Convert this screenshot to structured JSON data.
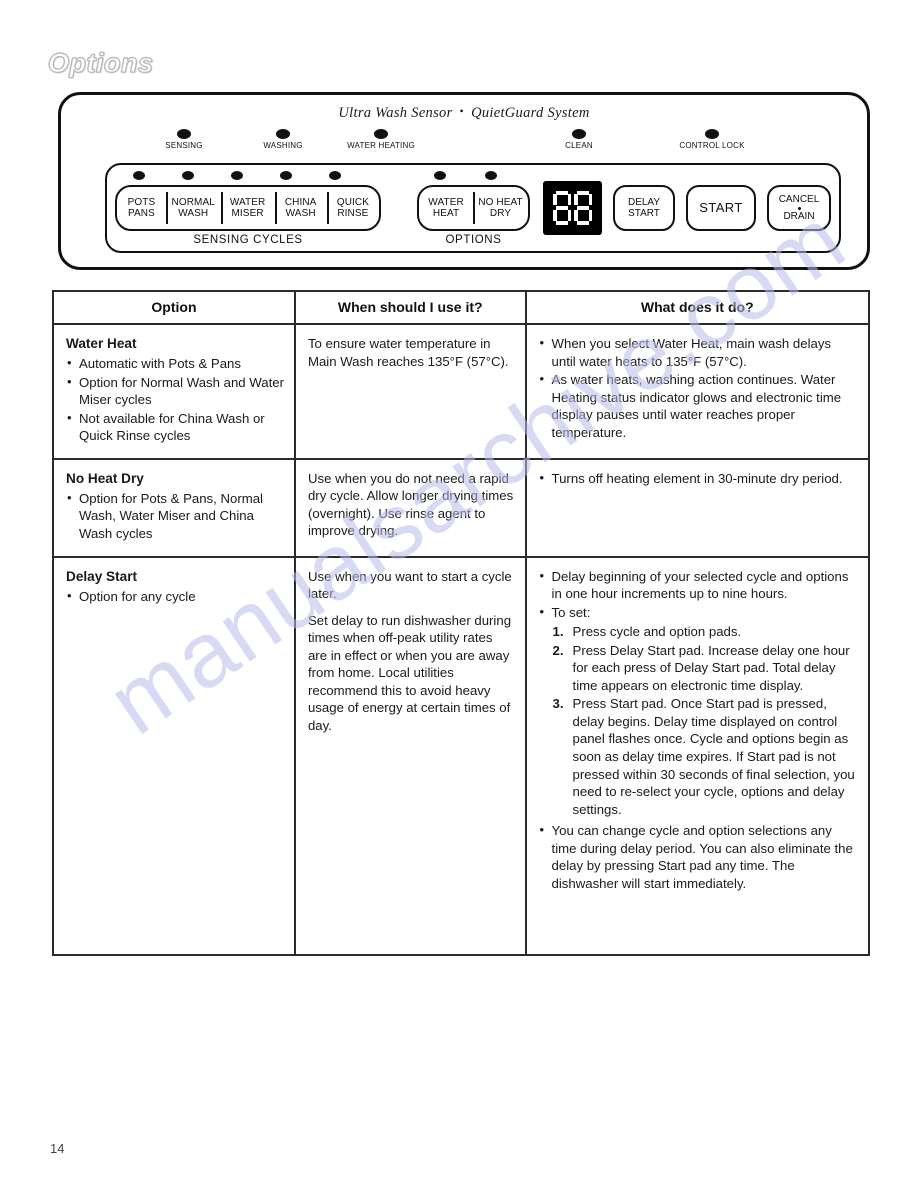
{
  "page": {
    "heading": "Options",
    "number": "14",
    "watermark": "manualsarchive.com"
  },
  "control_panel": {
    "brand_left": "Ultra Wash Sensor",
    "brand_separator": "•",
    "brand_right": "QuietGuard System",
    "status_leds": [
      {
        "label": "SENSING"
      },
      {
        "label": "WASHING"
      },
      {
        "label": "WATER HEATING"
      },
      {
        "label": "CLEAN"
      },
      {
        "label": "CONTROL LOCK"
      }
    ],
    "cycles_group": {
      "caption": "SENSING CYCLES",
      "pads": [
        {
          "line1": "POTS",
          "line2": "PANS"
        },
        {
          "line1": "NORMAL",
          "line2": "WASH"
        },
        {
          "line1": "WATER",
          "line2": "MISER"
        },
        {
          "line1": "CHINA",
          "line2": "WASH"
        },
        {
          "line1": "QUICK",
          "line2": "RINSE"
        }
      ]
    },
    "options_group": {
      "caption": "OPTIONS",
      "pads": [
        {
          "line1": "WATER",
          "line2": "HEAT"
        },
        {
          "line1": "NO HEAT",
          "line2": "DRY"
        }
      ]
    },
    "display": {
      "value": "88"
    },
    "buttons": [
      {
        "line1": "DELAY",
        "line2": "START"
      },
      {
        "line1": "START",
        "line2": ""
      },
      {
        "line1": "CANCEL",
        "line2": "DRAIN",
        "has_dot": true
      }
    ]
  },
  "table": {
    "headers": {
      "col1": "Option",
      "col2": "When should I use it?",
      "col3": "What does it do?"
    },
    "rows": [
      {
        "option_title": "Water Heat",
        "option_bullets": [
          "Automatic with Pots & Pans",
          "Option for Normal Wash and Water Miser cycles",
          "Not available for China Wash or Quick Rinse cycles"
        ],
        "when_paragraphs": [
          "To ensure water temperature in Main Wash reaches 135°F (57°C)."
        ],
        "what_bullets": [
          "When you select Water Heat, main wash delays until water heats to 135°F (57°C).",
          "As water heats, washing action continues. Water Heating status indicator glows and electronic time display pauses until water reaches proper temperature."
        ]
      },
      {
        "option_title": "No Heat Dry",
        "option_bullets": [
          "Option for Pots & Pans, Normal Wash, Water Miser and China Wash cycles"
        ],
        "when_paragraphs": [
          "Use when you do not need a rapid dry cycle. Allow longer drying times (overnight). Use rinse agent to improve drying."
        ],
        "what_bullets": [
          "Turns off heating element in 30-minute dry period."
        ]
      },
      {
        "option_title": "Delay Start",
        "option_bullets": [
          "Option for any cycle"
        ],
        "when_paragraphs": [
          "Use when you want to start a cycle later.",
          "Set delay to run dishwasher during times when off-peak utility rates are in effect or when you are away from home. Local utilities recommend this to avoid heavy usage of energy at certain times of day."
        ],
        "what_bullets": [
          "Delay beginning of your selected cycle and options in one hour increments up to nine hours.",
          "To set:"
        ],
        "steps": [
          {
            "num": "1.",
            "text": "Press cycle and option pads."
          },
          {
            "num": "2.",
            "text": "Press Delay Start pad. Increase delay one hour for each press of Delay Start pad. Total delay time appears on electronic time display."
          },
          {
            "num": "3.",
            "text": "Press Start pad. Once Start pad is pressed, delay begins. Delay time displayed on control panel flashes once. Cycle and options begin as soon as delay time expires. If Start pad is not pressed within 30 seconds of final selection, you need to re-select your cycle, options and delay settings."
          }
        ],
        "what_bullets_after": [
          "You can change cycle and option selections any time during delay period. You can also eliminate the delay by pressing Start pad any time. The dishwasher will start immediately."
        ]
      }
    ]
  }
}
